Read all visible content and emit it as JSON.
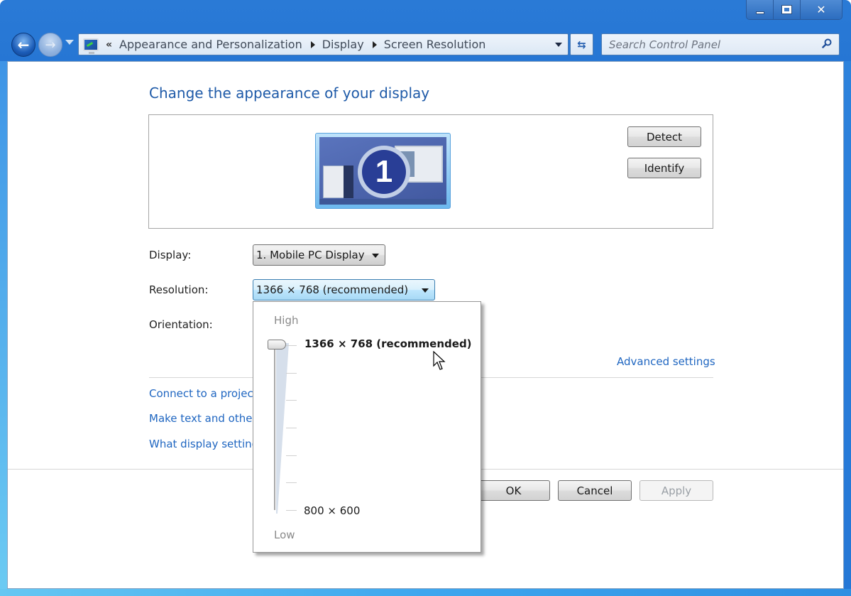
{
  "window": {
    "caption_buttons": {
      "minimize": "minimize",
      "maximize": "maximize",
      "close": "×"
    }
  },
  "nav": {
    "back_icon": "arrow-left",
    "forward_icon": "arrow-right"
  },
  "address_bar": {
    "overflow_chevron": "«",
    "breadcrumbs": [
      "Appearance and Personalization",
      "Display",
      "Screen Resolution"
    ]
  },
  "search": {
    "placeholder": "Search Control Panel"
  },
  "main": {
    "title": "Change the appearance of your display",
    "monitor_number": "1",
    "detect_label": "Detect",
    "identify_label": "Identify",
    "display_label": "Display:",
    "display_value": "1. Mobile PC Display",
    "resolution_label": "Resolution:",
    "resolution_value": "1366 × 768 (recommended)",
    "orientation_label": "Orientation:",
    "advanced_link": "Advanced settings",
    "links": [
      "Connect to a projector",
      "Make text and other items larger or smaller",
      "What display settings should I choose?"
    ],
    "ok_label": "OK",
    "cancel_label": "Cancel",
    "apply_label": "Apply"
  },
  "resolution_popup": {
    "high_label": "High",
    "low_label": "Low",
    "max_resolution": "1366 × 768 (recommended)",
    "min_resolution": "800 × 600",
    "slider_position": "max",
    "tick_count": 7
  }
}
